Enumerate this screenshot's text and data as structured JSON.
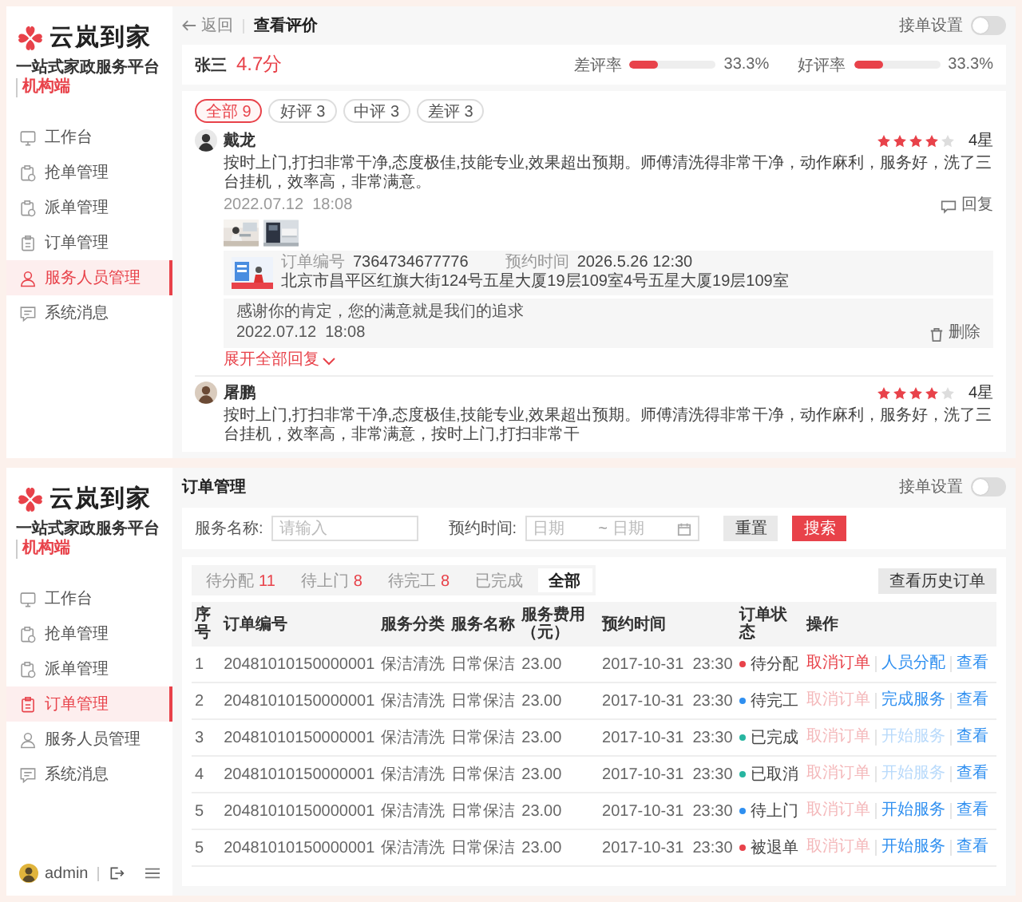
{
  "review_screen": {
    "sidebar": {
      "logo": {
        "name": "云岚到家",
        "tagline": "一站式家政服务平台",
        "role": "机构端"
      },
      "items": [
        {
          "label": "工作台",
          "selected": false
        },
        {
          "label": "抢单管理",
          "selected": false
        },
        {
          "label": "派单管理",
          "selected": false
        },
        {
          "label": "订单管理",
          "selected": false
        },
        {
          "label": "服务人员管理",
          "selected": true
        },
        {
          "label": "系统消息",
          "selected": false
        }
      ]
    },
    "header": {
      "back": "返回",
      "title": "查看评价",
      "switch_label": "接单设置",
      "switch_on": false
    },
    "summary": {
      "name": "张三",
      "score": "4.7分",
      "rates": [
        {
          "label": "差评率",
          "level": 0.333,
          "value": "33.3%"
        },
        {
          "label": "好评率",
          "level": 0.333,
          "value": "33.3%"
        }
      ]
    },
    "filters": [
      {
        "label": "全部 9",
        "selected": true
      },
      {
        "label": "好评 3",
        "selected": false
      },
      {
        "label": "中评 3",
        "selected": false
      },
      {
        "label": "差评 3",
        "selected": false
      }
    ],
    "reviews": [
      {
        "name": "戴龙",
        "stars": 4,
        "rating": "4星",
        "text": "按时上门,打扫非常干净,态度极佳,技能专业,效果超出预期。师傅清洗得非常干净，动作麻利，服务好，洗了三台挂机，效率高，非常满意。",
        "time": "2022.07.12  18:08",
        "reply_action": "回复",
        "photos": [
          {
            "kind": "picture"
          },
          {
            "kind": "picture"
          }
        ],
        "order": {
          "number_label": "订单编号",
          "number": "7364734677776",
          "time_label": "预约时间",
          "time": "2026.5.26 12:30",
          "address": "北京市昌平区红旗大街124号五星大厦19层109室4号五星大厦19层109室"
        },
        "replies": [
          {
            "text": "感谢你的肯定，您的满意就是我们的追求",
            "time": "2022.07.12  18:08",
            "action": "删除"
          }
        ],
        "expand": "展开全部回复"
      },
      {
        "name": "屠鹏",
        "stars": 4,
        "rating": "4星",
        "text": "按时上门,打扫非常干净,态度极佳,技能专业,效果超出预期。师傅清洗得非常干净，动作麻利，服务好，洗了三台挂机，效率高，非常满意，按时上门,打扫非常干"
      }
    ]
  },
  "order_screen": {
    "sidebar": {
      "logo": {
        "name": "云岚到家",
        "tagline": "一站式家政服务平台",
        "role": "机构端"
      },
      "items": [
        {
          "label": "工作台",
          "selected": false
        },
        {
          "label": "抢单管理",
          "selected": false
        },
        {
          "label": "派单管理",
          "selected": false
        },
        {
          "label": "订单管理",
          "selected": true
        },
        {
          "label": "服务人员管理",
          "selected": false
        },
        {
          "label": "系统消息",
          "selected": false
        }
      ],
      "user": "admin"
    },
    "header": {
      "title": "订单管理",
      "switch_label": "接单设置",
      "switch_on": false
    },
    "search": {
      "name_label": "服务名称:",
      "name_placeholder": "请输入",
      "date_label": "预约时间:",
      "start_placeholder": "日期",
      "separator": "~",
      "end_placeholder": "日期",
      "buttons": [
        {
          "label": "重置",
          "kind": "secondary"
        },
        {
          "label": "搜索",
          "kind": "primary"
        }
      ]
    },
    "tabs": [
      {
        "label": "待分配",
        "count": "11",
        "selected": false
      },
      {
        "label": "待上门",
        "count": "8",
        "selected": false
      },
      {
        "label": "待完工",
        "count": "8",
        "selected": false
      },
      {
        "label": "已完成",
        "selected": false
      },
      {
        "label": "全部",
        "selected": true
      }
    ],
    "history_button": "查看历史订单",
    "table": {
      "columns": [
        "序号",
        "订单编号",
        "服务分类",
        "服务名称",
        "服务费用（元）",
        "预约时间",
        "订单状态",
        "操作"
      ],
      "rows": [
        {
          "cells": [
            "1",
            "20481010150000001",
            "保洁清洗",
            "日常保洁",
            "23.00",
            "2017-10-31  23:30"
          ],
          "status": {
            "label": "待分配",
            "color": "#e8424a"
          },
          "actions": [
            {
              "label": "取消订单",
              "kind": "danger",
              "disabled": false
            },
            {
              "label": "人员分配",
              "kind": "link",
              "disabled": false
            },
            {
              "label": "查看",
              "kind": "link",
              "disabled": false
            }
          ]
        },
        {
          "cells": [
            "2",
            "20481010150000001",
            "保洁清洗",
            "日常保洁",
            "23.00",
            "2017-10-31  23:30"
          ],
          "status": {
            "label": "待完工",
            "color": "#2f8ff0"
          },
          "actions": [
            {
              "label": "取消订单",
              "kind": "danger",
              "disabled": true
            },
            {
              "label": "完成服务",
              "kind": "link",
              "disabled": false
            },
            {
              "label": "查看",
              "kind": "link",
              "disabled": false
            }
          ]
        },
        {
          "cells": [
            "3",
            "20481010150000001",
            "保洁清洗",
            "日常保洁",
            "23.00",
            "2017-10-31  23:30"
          ],
          "status": {
            "label": "已完成",
            "color": "#27b5a0"
          },
          "actions": [
            {
              "label": "取消订单",
              "kind": "danger",
              "disabled": true
            },
            {
              "label": "开始服务",
              "kind": "link",
              "disabled": true
            },
            {
              "label": "查看",
              "kind": "link",
              "disabled": false
            }
          ]
        },
        {
          "cells": [
            "4",
            "20481010150000001",
            "保洁清洗",
            "日常保洁",
            "23.00",
            "2017-10-31  23:30"
          ],
          "status": {
            "label": "已取消",
            "color": "#27b5a0"
          },
          "actions": [
            {
              "label": "取消订单",
              "kind": "danger",
              "disabled": true
            },
            {
              "label": "开始服务",
              "kind": "link",
              "disabled": true
            },
            {
              "label": "查看",
              "kind": "link",
              "disabled": false
            }
          ]
        },
        {
          "cells": [
            "5",
            "20481010150000001",
            "保洁清洗",
            "日常保洁",
            "23.00",
            "2017-10-31  23:30"
          ],
          "status": {
            "label": "待上门",
            "color": "#2f8ff0"
          },
          "actions": [
            {
              "label": "取消订单",
              "kind": "danger",
              "disabled": true
            },
            {
              "label": "开始服务",
              "kind": "link",
              "disabled": false
            },
            {
              "label": "查看",
              "kind": "link",
              "disabled": false
            }
          ]
        },
        {
          "cells": [
            "5",
            "20481010150000001",
            "保洁清洗",
            "日常保洁",
            "23.00",
            "2017-10-31  23:30"
          ],
          "status": {
            "label": "被退单",
            "color": "#e8424a"
          },
          "actions": [
            {
              "label": "取消订单",
              "kind": "danger",
              "disabled": true
            },
            {
              "label": "开始服务",
              "kind": "link",
              "disabled": false
            },
            {
              "label": "查看",
              "kind": "link",
              "disabled": false
            }
          ]
        }
      ]
    }
  }
}
